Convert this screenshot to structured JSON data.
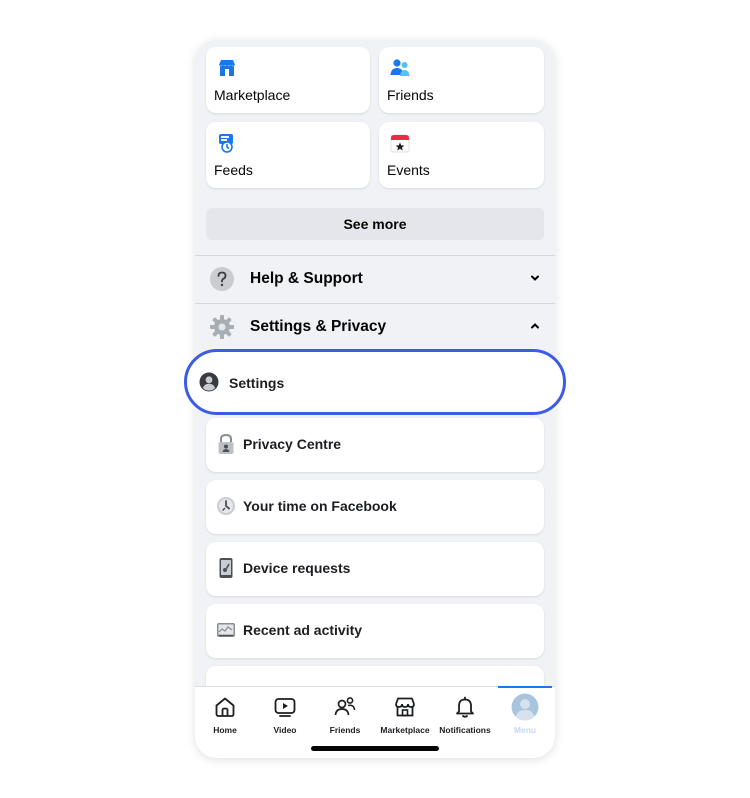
{
  "shortcuts": [
    {
      "label": "Marketplace",
      "icon": "marketplace-icon"
    },
    {
      "label": "Friends",
      "icon": "friends-icon"
    },
    {
      "label": "Feeds",
      "icon": "feeds-icon"
    },
    {
      "label": "Events",
      "icon": "events-icon"
    }
  ],
  "see_more_label": "See more",
  "sections": {
    "help": {
      "label": "Help & Support",
      "icon": "question-icon",
      "state": "collapsed"
    },
    "settings_privacy": {
      "label": "Settings & Privacy",
      "icon": "gear-icon",
      "state": "expanded"
    }
  },
  "settings_items": [
    {
      "label": "Settings",
      "icon": "profile-icon",
      "highlighted": true
    },
    {
      "label": "Privacy Centre",
      "icon": "lock-icon"
    },
    {
      "label": "Your time on Facebook",
      "icon": "clock-icon"
    },
    {
      "label": "Device requests",
      "icon": "device-icon"
    },
    {
      "label": "Recent ad activity",
      "icon": "ad-activity-icon"
    }
  ],
  "tabs": [
    {
      "label": "Home",
      "icon": "home-icon"
    },
    {
      "label": "Video",
      "icon": "video-icon"
    },
    {
      "label": "Friends",
      "icon": "friends-outline-icon"
    },
    {
      "label": "Marketplace",
      "icon": "store-icon"
    },
    {
      "label": "Notifications",
      "icon": "bell-icon"
    },
    {
      "label": "Menu",
      "icon": "avatar-icon",
      "active": true
    }
  ],
  "colors": {
    "highlight_border": "#3b5ce4",
    "background": "#f0f2f5",
    "active_tab": "#1877f2"
  }
}
